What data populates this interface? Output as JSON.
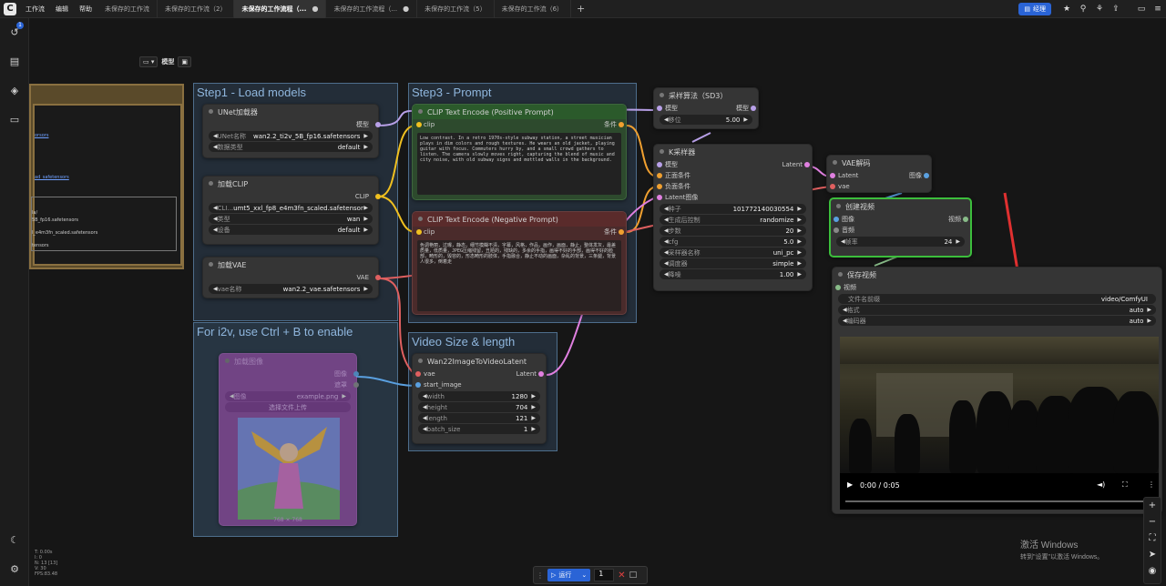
{
  "menu": [
    "工作流",
    "编辑",
    "帮助"
  ],
  "tabs": [
    {
      "label": "未保存的工作流",
      "active": false
    },
    {
      "label": "未保存的工作流（2）",
      "active": false
    },
    {
      "label": "未保存的工作流程（...",
      "active": true
    },
    {
      "label": "未保存的工作流程（...",
      "active": false
    },
    {
      "label": "未保存的工作流（5）",
      "active": false
    },
    {
      "label": "未保存的工作流（6）",
      "active": false
    }
  ],
  "toolbar": {
    "queue_label": "经理"
  },
  "sidebar": {
    "badge": "1"
  },
  "canvas_tools": {
    "mode_label": "模型"
  },
  "left_panel": {
    "lines": [
      "orsors",
      "ad_safetensors",
      "la/",
      "5B_fp16.safetensors",
      "l_e4m3fn_scaled.safetensors",
      "tensors"
    ]
  },
  "groups": {
    "step1": "Step1 - Load models",
    "step3": "Step3 - Prompt",
    "i2v": "For i2v, use Ctrl + B to enable",
    "video_size": "Video Size & length"
  },
  "nodes": {
    "unet": {
      "title": "UNet加载器",
      "out": "模型",
      "w1_label": "UNet名称",
      "w1_val": "wan2.2_ti2v_5B_fp16.safetensors",
      "w2_label": "数据类型",
      "w2_val": "default"
    },
    "clip_loader": {
      "title": "加载CLIP",
      "out": "CLIP",
      "w1_label": "CLI...",
      "w1_val": "umt5_xxl_fp8_e4m3fn_scaled.safetensors",
      "w2_label": "类型",
      "w2_val": "wan",
      "w3_label": "设备",
      "w3_val": "default"
    },
    "vae_loader": {
      "title": "加载VAE",
      "out": "VAE",
      "w1_label": "vae名称",
      "w1_val": "wan2.2_vae.safetensors"
    },
    "positive": {
      "title": "CLIP Text Encode (Positive Prompt)",
      "in": "clip",
      "out": "条件",
      "text": "Low contrast. In a retro 1970s-style subway station, a street musician plays in dim colors and rough textures. He wears an old jacket, playing guitar with focus. Commuters hurry by, and a small crowd gathers to listen. The camera slowly moves right, capturing the blend of music and city noise, with old subway signs and mottled walls in the background."
    },
    "negative": {
      "title": "CLIP Text Encode (Negative Prompt)",
      "in": "clip",
      "out": "条件",
      "text": "色调艳丽，过曝，静态，细节模糊不清，字幕，风格，作品，画作，画面，静止，整体发灰，最差质量，低质量，JPEG压缩残留，丑陋的，残缺的，多余的手指，画得不好的手部，画得不好的脸部，畸形的，毁容的，形态畸形的肢体，手指融合，静止不动的画面，杂乱的背景，三条腿，背景人很多，倒着走"
    },
    "sampling": {
      "title": "采样算法（SD3）",
      "in": "模型",
      "out": "模型",
      "w1_label": "移位",
      "w1_val": "5.00"
    },
    "ksampler": {
      "title": "K采样器",
      "inputs": [
        "模型",
        "正面条件",
        "负面条件",
        "Latent图像"
      ],
      "out": "Latent",
      "widgets": [
        {
          "label": "种子",
          "value": "1017721400305​54"
        },
        {
          "label": "生成后控制",
          "value": "randomize"
        },
        {
          "label": "步数",
          "value": "20"
        },
        {
          "label": "cfg",
          "value": "5.0"
        },
        {
          "label": "采样器名称",
          "value": "uni_pc"
        },
        {
          "label": "调度器",
          "value": "simple"
        },
        {
          "label": "降噪",
          "value": "1.00"
        }
      ]
    },
    "vae_decode": {
      "title": "VAE解码",
      "in1": "Latent",
      "in2": "vae",
      "out": "图像"
    },
    "create_video": {
      "title": "创建视频",
      "in1": "图像",
      "in2": "音频",
      "out": "视频",
      "w1_label": "帧率",
      "w1_val": "24"
    },
    "save_video": {
      "title": "保存视频",
      "in": "视频",
      "widgets": [
        {
          "label": "文件名前缀",
          "value": "video/ComfyUI"
        },
        {
          "label": "格式",
          "value": "auto"
        },
        {
          "label": "编码器",
          "value": "auto"
        }
      ]
    },
    "load_image": {
      "title": "加载图像",
      "out1": "图像",
      "out2": "遮罩",
      "w1_label": "图像",
      "w1_val": "example.png",
      "upload": "选择文件上传",
      "caption": "768 × 768"
    },
    "wan22": {
      "title": "Wan22ImageToVideoLatent",
      "in1": "vae",
      "in2": "start_image",
      "out": "Latent",
      "widgets": [
        {
          "label": "width",
          "value": "1280"
        },
        {
          "label": "height",
          "value": "704"
        },
        {
          "label": "length",
          "value": "121"
        },
        {
          "label": "batch_size",
          "value": "1"
        }
      ]
    }
  },
  "video": {
    "time": "0:00 / 0:05"
  },
  "info": [
    "T: 0.00s",
    "I: 0",
    "N: 13 [13]",
    "V: 30",
    "FPS:83.48"
  ],
  "runbar": {
    "run_label": "运行",
    "count": "1"
  },
  "watermark": {
    "title": "激活 Windows",
    "subtitle": "转到\"设置\"以激活 Windows。"
  },
  "colors": {
    "accent": "#2a64d6",
    "group": "#4e6e8c",
    "link_yellow": "#f0c020",
    "link_red": "#e06060",
    "link_pink": "#e080e0",
    "link_blue": "#5aa0e0"
  }
}
